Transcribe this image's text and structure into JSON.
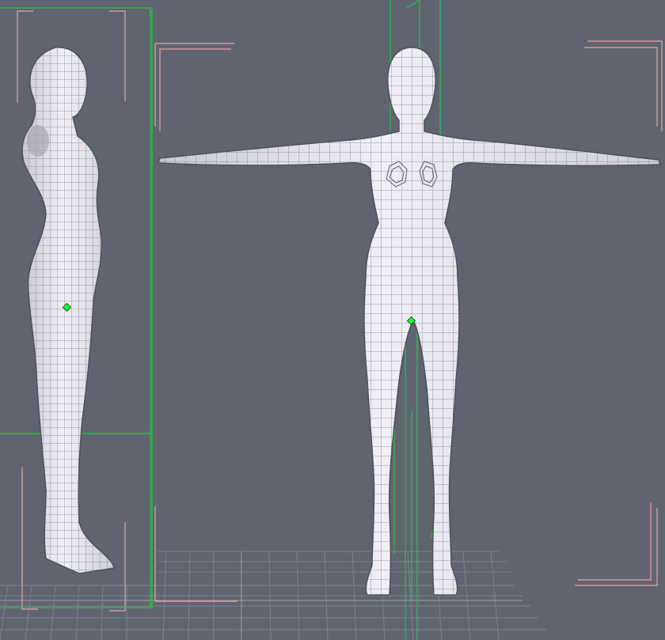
{
  "viewport": {
    "background_color": "#5f6470",
    "grid_color": "#7e8390",
    "mesh_fill": "#e9e7ee",
    "mesh_line": "#5b5e6a",
    "camera_frame_color": "#e6a3a3",
    "bounding_box_color": "#2fb84a",
    "pivot_color": "#19ff3a"
  },
  "icons": {
    "side_view_figure": "figure-side-view-icon",
    "front_view_figure": "figure-front-view-icon",
    "pivot": "pivot-handle-icon"
  }
}
